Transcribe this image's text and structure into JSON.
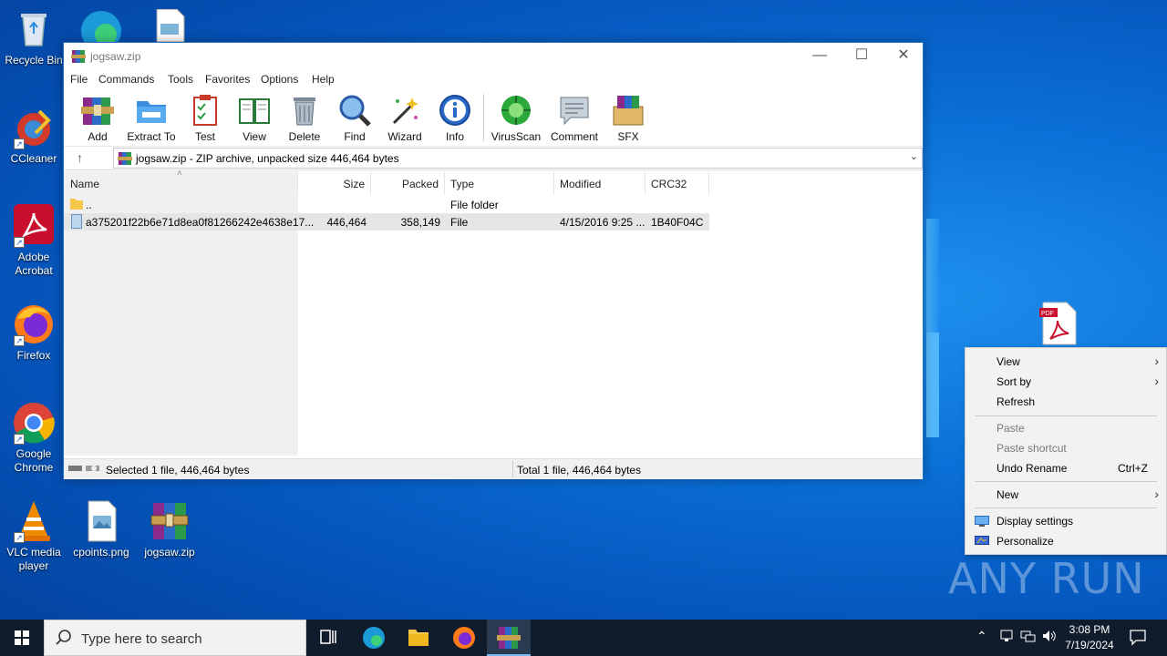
{
  "desktop": {
    "icons": [
      {
        "label": "Recycle Bin"
      },
      {
        "label": "CCleaner"
      },
      {
        "label": "Adobe Acrobat"
      },
      {
        "label": "Firefox"
      },
      {
        "label": "Google Chrome"
      },
      {
        "label": "VLC media player"
      },
      {
        "label": "cpoints.png"
      },
      {
        "label": "jogsaw.zip"
      }
    ]
  },
  "window": {
    "title": "jogsaw.zip",
    "menu": [
      "File",
      "Commands",
      "Tools",
      "Favorites",
      "Options",
      "Help"
    ],
    "toolbar": [
      "Add",
      "Extract To",
      "Test",
      "View",
      "Delete",
      "Find",
      "Wizard",
      "Info",
      "VirusScan",
      "Comment",
      "SFX"
    ],
    "path": "jogsaw.zip - ZIP archive, unpacked size 446,464 bytes",
    "columns": [
      "Name",
      "Size",
      "Packed",
      "Type",
      "Modified",
      "CRC32"
    ],
    "rows": [
      {
        "name": "..",
        "size": "",
        "packed": "",
        "type": "File folder",
        "modified": "",
        "crc": ""
      },
      {
        "name": "a375201f22b6e71d8ea0f81266242e4638e17...",
        "size": "446,464",
        "packed": "358,149",
        "type": "File",
        "modified": "4/15/2016 9:25 ...",
        "crc": "1B40F04C"
      }
    ],
    "status_left": "Selected 1 file, 446,464 bytes",
    "status_right": "Total 1 file, 446,464 bytes"
  },
  "context_menu": {
    "items": [
      "View",
      "Sort by",
      "Refresh",
      "Paste",
      "Paste shortcut",
      "Undo Rename",
      "New",
      "Display settings",
      "Personalize"
    ],
    "undo_shortcut": "Ctrl+Z"
  },
  "taskbar": {
    "search_placeholder": "Type here to search",
    "time": "3:08 PM",
    "date": "7/19/2024"
  },
  "watermark": "ANY RUN",
  "colors": {
    "accent": "#1e72c8",
    "taskbar": "#101b2b",
    "desktop": "#0a6fd6"
  }
}
